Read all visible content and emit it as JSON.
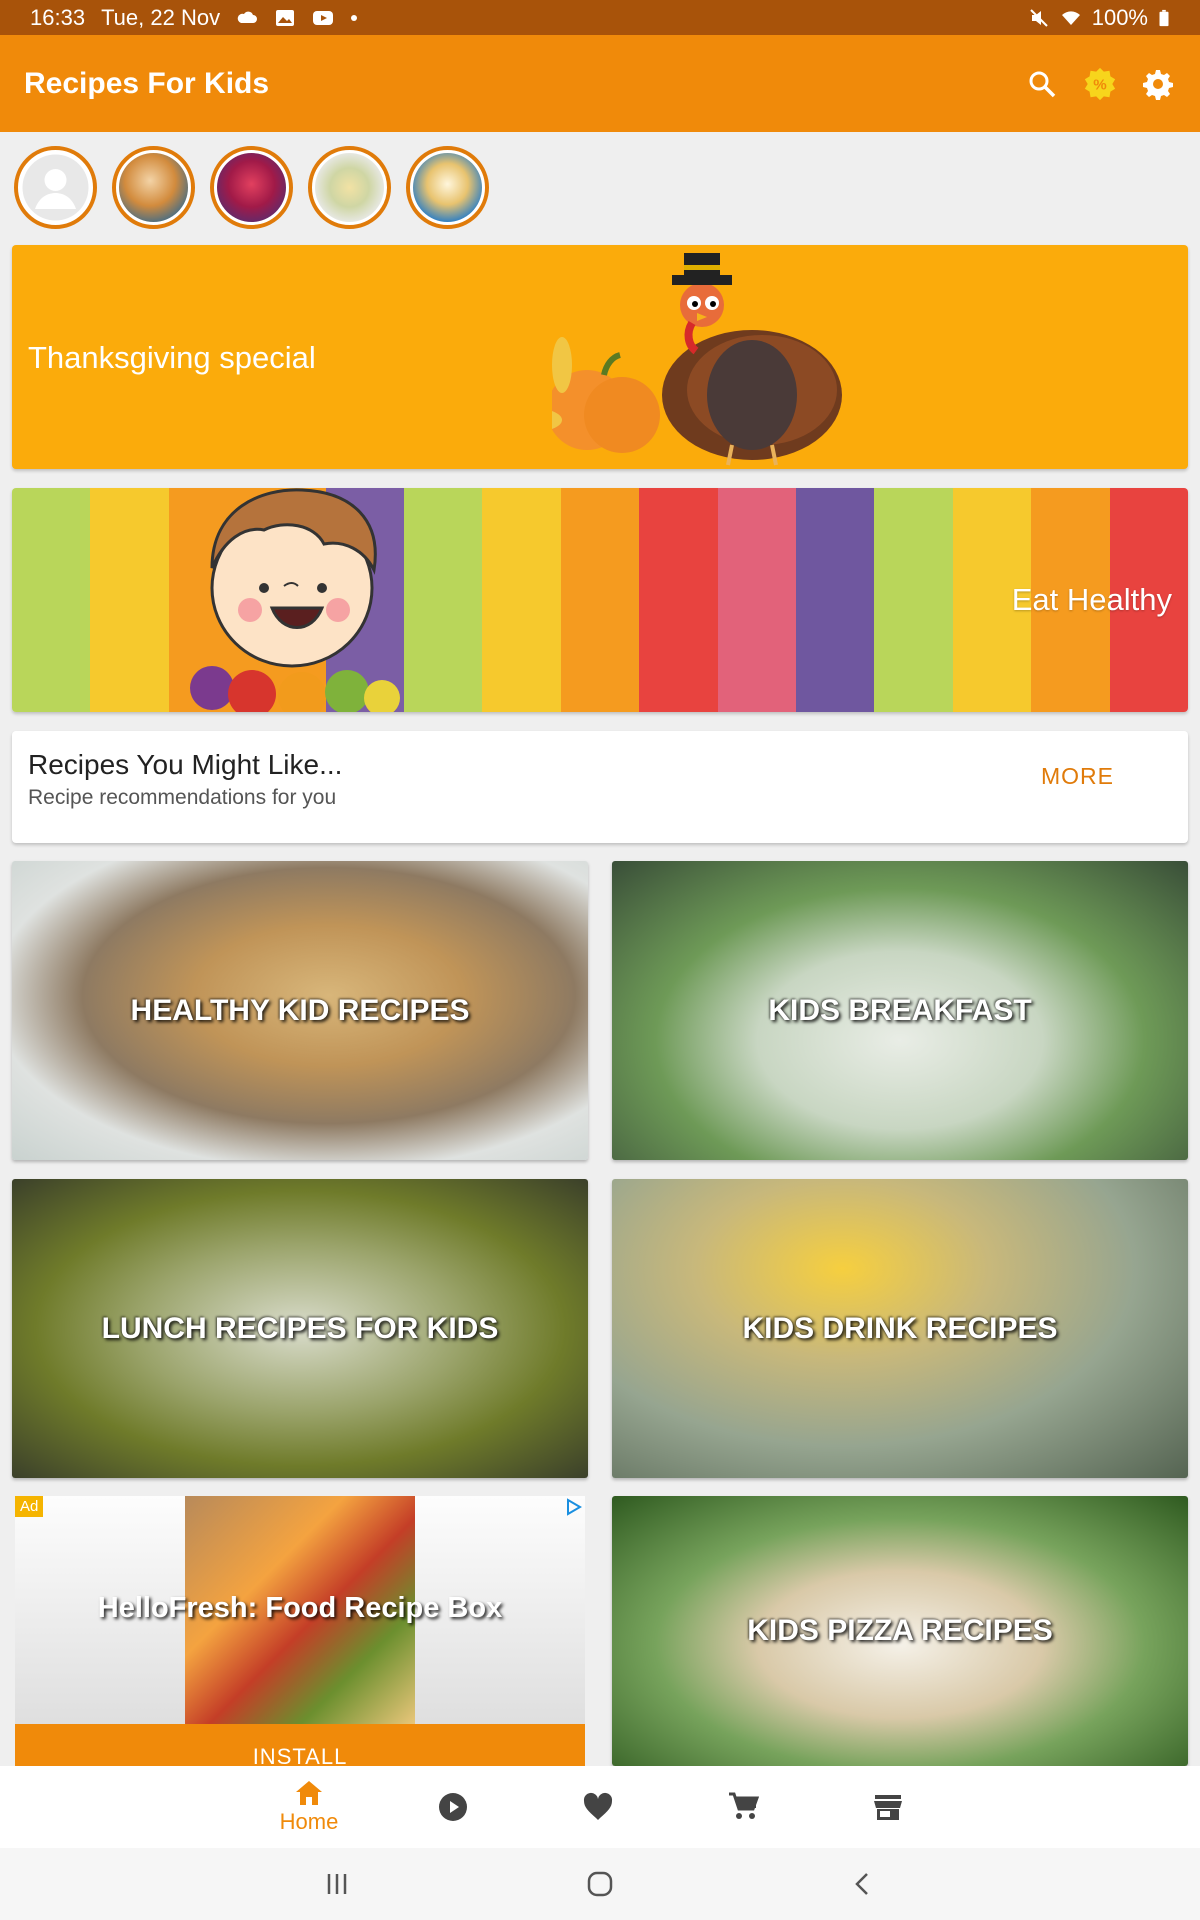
{
  "status_bar": {
    "time": "16:33",
    "date": "Tue, 22 Nov",
    "battery": "100%",
    "icons": [
      "cloud-icon",
      "image-icon",
      "youtube-icon",
      "dot-icon",
      "mute-icon",
      "wifi-icon",
      "battery-icon"
    ]
  },
  "app_bar": {
    "title": "Recipes For Kids",
    "actions": [
      "search-icon",
      "discount-badge-icon",
      "settings-icon"
    ]
  },
  "stories": [
    "user-avatar",
    "story-chef-kid",
    "story-berries",
    "story-toast-plate",
    "story-sandwich"
  ],
  "banners": {
    "thanksgiving": "Thanksgiving special",
    "eat_healthy": "Eat Healthy"
  },
  "recommendations": {
    "title": "Recipes You Might Like...",
    "subtitle": "Recipe recommendations for you",
    "more_label": "MORE"
  },
  "categories": {
    "healthy": "HEALTHY KID RECIPES",
    "breakfast": "KIDS BREAKFAST",
    "lunch": "LUNCH RECIPES FOR KIDS",
    "drink": "KIDS DRINK RECIPES",
    "pizza": "KIDS PIZZA RECIPES"
  },
  "ad": {
    "badge": "Ad",
    "title": "HelloFresh: Food Recipe Box",
    "cta": "INSTALL"
  },
  "bottom_nav": {
    "home_label": "Home",
    "items": [
      "home-icon",
      "play-icon",
      "heart-icon",
      "cart-icon",
      "store-icon"
    ]
  },
  "colors": {
    "accent": "#f08a0a",
    "status_bar": "#a8530a",
    "banner_orange": "#fbab0b",
    "stripes": [
      "#b9d65a",
      "#f6c92d",
      "#f59b1f",
      "#f59b1f",
      "#7b5ea5",
      "#b9d65a",
      "#f6c92d",
      "#f59b1f",
      "#e8433f",
      "#e2627a",
      "#6f579f",
      "#b9d65a",
      "#f6c92d",
      "#f59b1f",
      "#e8433f"
    ]
  }
}
